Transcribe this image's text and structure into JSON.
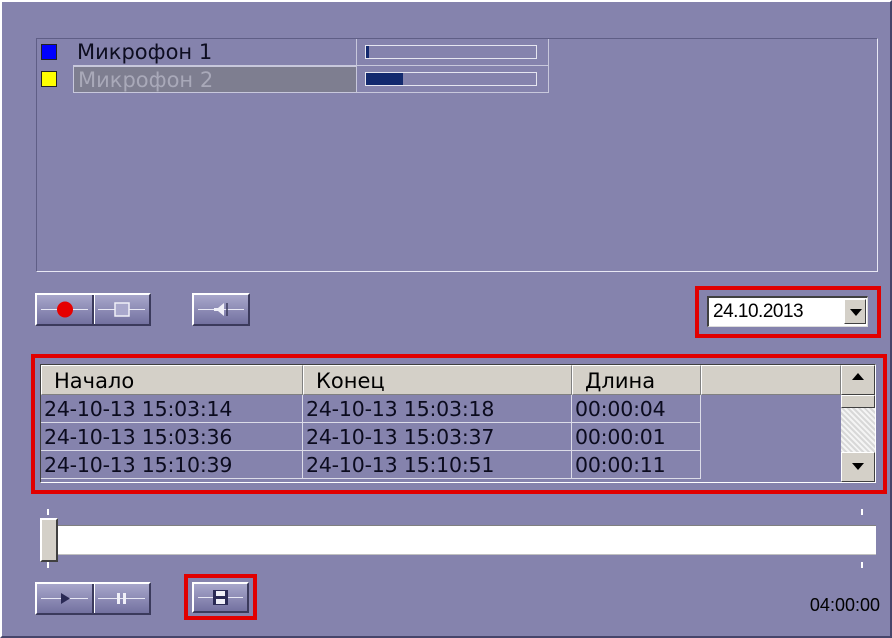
{
  "microphones": [
    {
      "name": "Микрофон 1",
      "color": "#0000ff",
      "level": 0.02,
      "selected": false
    },
    {
      "name": "Микрофон 2",
      "color": "#ffff00",
      "level": 0.22,
      "selected": true
    }
  ],
  "controls": {
    "record_icon": "record-icon",
    "stop_icon": "stop-icon",
    "speaker_icon": "speaker-icon",
    "play_icon": "play-icon",
    "pause_icon": "pause-icon",
    "save_icon": "save-icon"
  },
  "date_filter": {
    "value": "24.10.2013"
  },
  "table": {
    "columns": [
      "Начало",
      "Конец",
      "Длина"
    ],
    "rows": [
      [
        "24-10-13 15:03:14",
        "24-10-13 15:03:18",
        "00:00:04"
      ],
      [
        "24-10-13 15:03:36",
        "24-10-13 15:03:37",
        "00:00:01"
      ],
      [
        "24-10-13 15:10:39",
        "24-10-13 15:10:51",
        "00:00:11"
      ]
    ]
  },
  "playback": {
    "position": 0.0,
    "total_time": "04:00:00"
  },
  "colors": {
    "highlight": "#e10000",
    "panel": "#8583ad"
  }
}
